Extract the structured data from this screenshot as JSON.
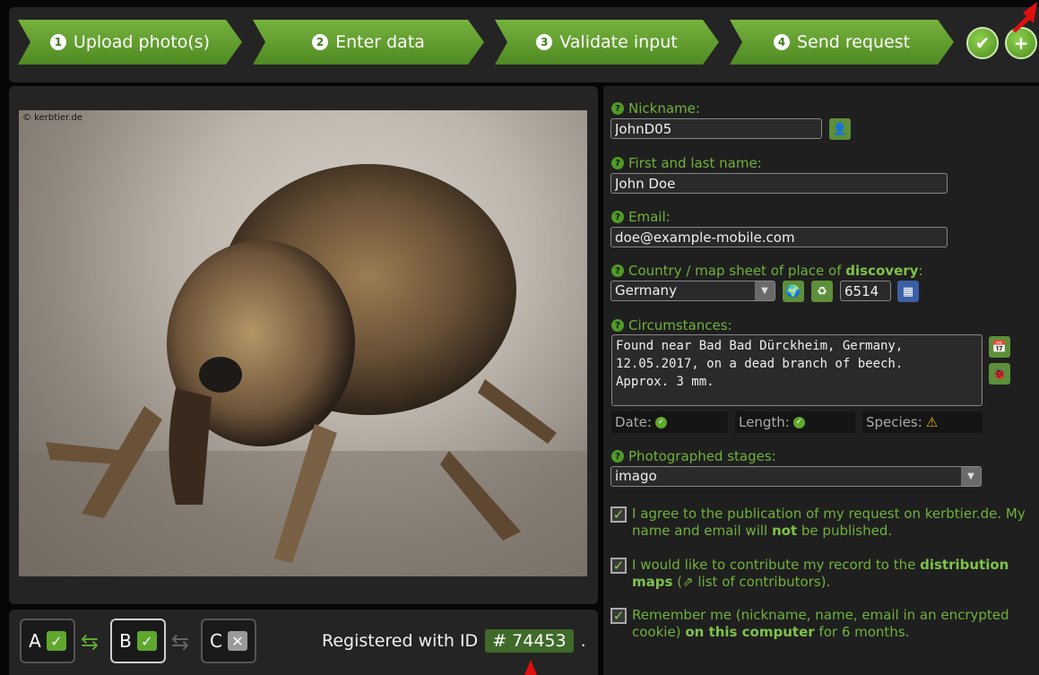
{
  "steps": [
    {
      "num": "1",
      "label": "Upload photo(s)"
    },
    {
      "num": "2",
      "label": "Enter data"
    },
    {
      "num": "3",
      "label": "Validate input"
    },
    {
      "num": "4",
      "label": "Send request"
    }
  ],
  "photo": {
    "copyright": "© kerbtier.de"
  },
  "form": {
    "nickname": {
      "label": "Nickname:",
      "value": "JohnD05"
    },
    "name": {
      "label": "First and last name:",
      "value": "John Doe"
    },
    "email": {
      "label": "Email:",
      "value": "doe@example-mobile.com"
    },
    "country": {
      "label_pre": "Country / map sheet of place of ",
      "label_bold": "discovery",
      "label_post": ":",
      "value": "Germany",
      "map_sheet": "6514"
    },
    "circumstances": {
      "label": "Circumstances:",
      "value": "Found near Bad Bad Dürckheim, Germany,\n12.05.2017, on a dead branch of beech.\nApprox. 3 mm."
    },
    "status": {
      "date": "Date:",
      "length": "Length:",
      "species": "Species:"
    },
    "stages": {
      "label": "Photographed stages:",
      "value": "imago"
    },
    "agree": {
      "text1": "I agree to the publication of my request on kerbtier.de. My name and email will ",
      "bold": "not",
      "text2": " be published."
    },
    "contribute": {
      "text1": "I would like to contribute my record to the ",
      "bold": "distribution maps",
      "text2": " (",
      "link": "list of contributors",
      "text3": ")."
    },
    "remember": {
      "text1": "Remember me (nickname, name, email in an encrypted cookie) ",
      "bold": "on this computer",
      "text2": " for 6 months."
    }
  },
  "bottom": {
    "a": "A",
    "b": "B",
    "c": "C",
    "registered_label": "Registered with ID",
    "id": "# 74453",
    "dot": "."
  },
  "colors": {
    "accent": "#5fa82e",
    "label": "#6fb23a",
    "id_bg": "#3f6a2a"
  }
}
